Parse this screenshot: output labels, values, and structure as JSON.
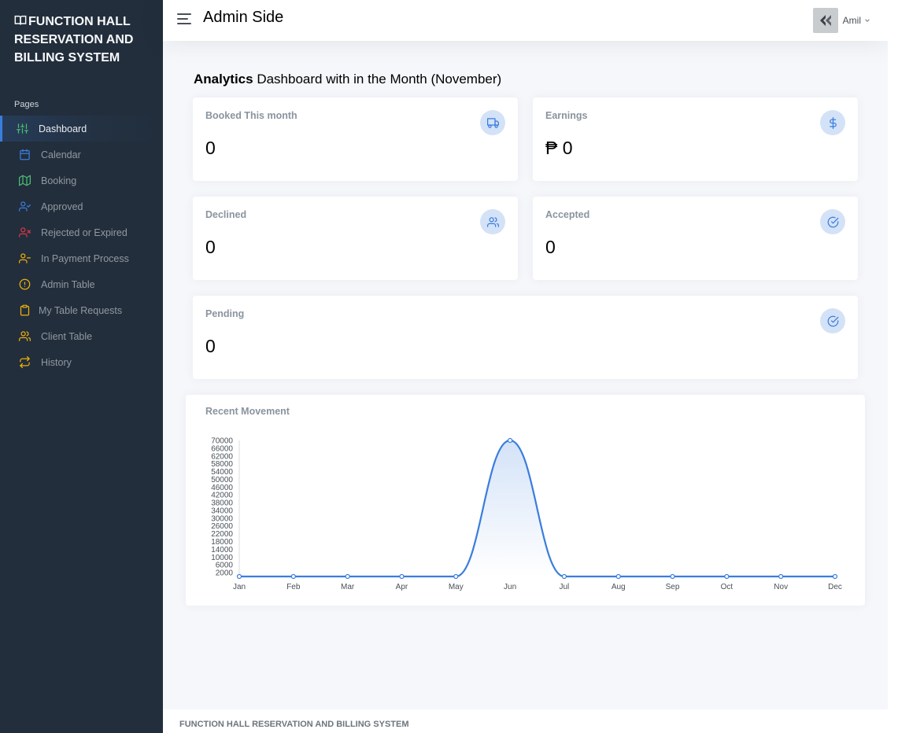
{
  "app": {
    "brand_lines": [
      "FUNCTION HALL",
      "RESERVATION AND",
      "BILLING SYSTEM"
    ],
    "brand_icon": "book-icon"
  },
  "sidebar": {
    "header": "Pages",
    "items": [
      {
        "label": "Dashboard",
        "icon": "sliders-icon",
        "color": "#4bbf73",
        "active": true
      },
      {
        "label": "Calendar",
        "icon": "calendar-icon",
        "color": "#3b7ddd"
      },
      {
        "label": "Booking",
        "icon": "map-icon",
        "color": "#4bbf73"
      },
      {
        "label": "Approved",
        "icon": "user-check-icon",
        "color": "#3b7ddd"
      },
      {
        "label": "Rejected or Expired",
        "icon": "user-x-icon",
        "color": "#dc3545"
      },
      {
        "label": "In Payment Process",
        "icon": "user-minus-icon",
        "color": "#f0b00a"
      },
      {
        "label": "Admin Table",
        "icon": "alert-circle-icon",
        "color": "#f0b00a"
      },
      {
        "label": "My Table Requests",
        "icon": "clipboard-icon",
        "color": "#f0b00a"
      },
      {
        "label": "Client Table",
        "icon": "users-icon",
        "color": "#f0b00a"
      },
      {
        "label": "History",
        "icon": "repeat-icon",
        "color": "#f0b00a"
      }
    ]
  },
  "topbar": {
    "title": "Admin Side",
    "user_name": "Amil"
  },
  "main": {
    "heading_bold": "Analytics",
    "heading_rest": " Dashboard with in the Month (November)",
    "cards": {
      "booked": {
        "label": "Booked This month",
        "value": "0",
        "icon": "truck-icon"
      },
      "earnings": {
        "label": "Earnings",
        "value": "₱ 0",
        "icon": "dollar-sign-icon"
      },
      "declined": {
        "label": "Declined",
        "value": "0",
        "icon": "users-icon"
      },
      "accepted": {
        "label": "Accepted",
        "value": "0",
        "icon": "check-circle-icon"
      },
      "pending": {
        "label": "Pending",
        "value": "0",
        "icon": "check-circle-icon"
      }
    },
    "chart_title": "Recent Movement"
  },
  "chart_data": {
    "type": "area",
    "title": "Recent Movement",
    "categories": [
      "Jan",
      "Feb",
      "Mar",
      "Apr",
      "May",
      "Jun",
      "Jul",
      "Aug",
      "Sep",
      "Oct",
      "Nov",
      "Dec"
    ],
    "values": [
      0,
      0,
      0,
      0,
      0,
      70000,
      0,
      0,
      0,
      0,
      0,
      0
    ],
    "y_ticks": [
      2000,
      6000,
      10000,
      14000,
      18000,
      22000,
      26000,
      30000,
      34000,
      38000,
      42000,
      46000,
      50000,
      54000,
      58000,
      62000,
      66000,
      70000
    ],
    "ylim": [
      0,
      70000
    ],
    "grid": false,
    "line_color": "#3b7ddd"
  },
  "footer": {
    "text": "FUNCTION HALL RESERVATION AND BILLING SYSTEM"
  }
}
